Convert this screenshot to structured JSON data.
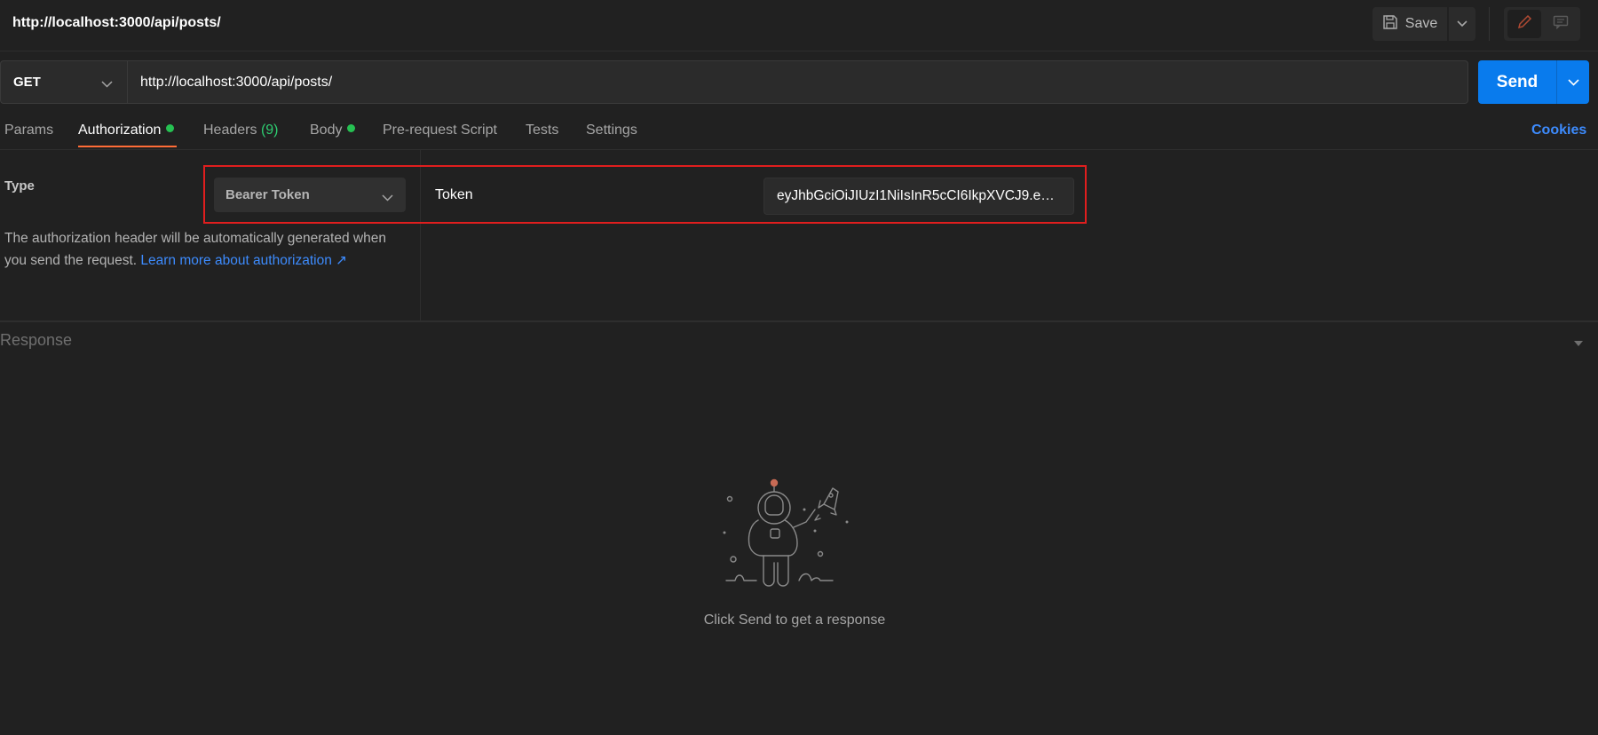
{
  "header": {
    "title": "http://localhost:3000/api/posts/",
    "save_label": "Save",
    "icons": {
      "save": "save-icon",
      "save_dropdown": "chevron-down-icon",
      "edit": "pencil-icon",
      "comments": "comment-icon"
    }
  },
  "request": {
    "method": "GET",
    "url": "http://localhost:3000/api/posts/",
    "send_label": "Send"
  },
  "tabs": [
    {
      "label": "Params",
      "active": false
    },
    {
      "label": "Authorization",
      "active": true,
      "indicator": true
    },
    {
      "label": "Headers",
      "count": "(9)",
      "active": false
    },
    {
      "label": "Body",
      "active": false,
      "indicator": true
    },
    {
      "label": "Pre-request Script",
      "active": false
    },
    {
      "label": "Tests",
      "active": false
    },
    {
      "label": "Settings",
      "active": false
    }
  ],
  "cookies_label": "Cookies",
  "auth": {
    "type_label": "Type",
    "type_value": "Bearer Token",
    "description": "The authorization header will be automatically generated when you send the request.",
    "learn_more": "Learn more about authorization ↗",
    "token_label": "Token",
    "token_value": "eyJhbGciOiJIUzI1NiIsInR5cCI6IkpXVCJ9.eyJ..."
  },
  "response": {
    "label": "Response",
    "empty_message": "Click Send to get a response",
    "illustration": "astronaut-rocket-illustration"
  },
  "colors": {
    "background": "#212121",
    "accent": "#ff6c37",
    "send": "#097bed",
    "link": "#3d8bfd",
    "indicator": "#26c152",
    "highlight": "#e01e1e"
  }
}
